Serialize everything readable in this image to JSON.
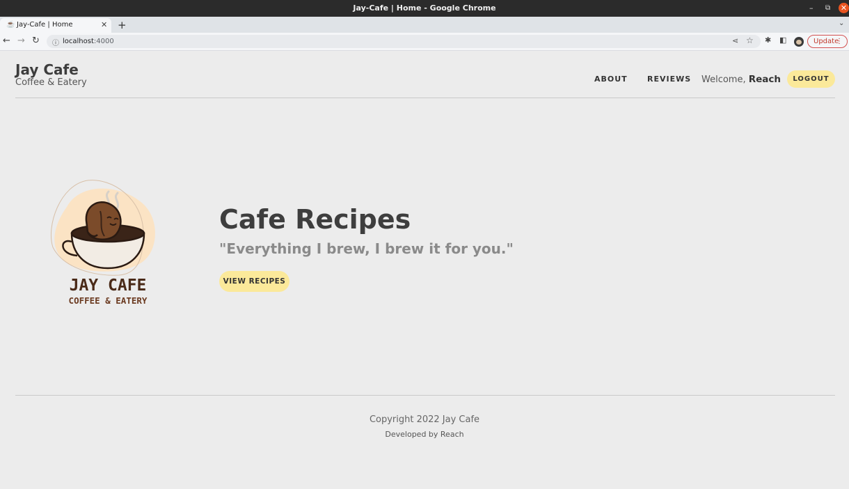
{
  "window": {
    "title": "Jay-Cafe | Home - Google Chrome",
    "controls": {
      "minimize": "–",
      "maximize": "⧉",
      "close": "✕"
    }
  },
  "browser": {
    "tab_title": "Jay-Cafe | Home",
    "tab_close": "✕",
    "new_tab": "+",
    "tab_menu": "⌄",
    "url_host": "localhost",
    "url_port": ":4000",
    "update_label": "Update",
    "update_menu": "⋮",
    "icons": {
      "back": "←",
      "forward": "→",
      "reload": "↻",
      "info": "ⓘ",
      "share": "⋖",
      "star": "☆",
      "extensions": "✱",
      "side_panel": "◧",
      "favicon": "☕"
    }
  },
  "header": {
    "brand_name": "Jay Cafe",
    "brand_tagline": "Coffee & Eatery",
    "nav": {
      "about": "ABOUT",
      "reviews": "REVIEWS"
    },
    "welcome_prefix": "Welcome, ",
    "username": "Reach",
    "logout_label": "LOGOUT"
  },
  "hero": {
    "logo_title": "JAY CAFE",
    "logo_subtitle": "COFFEE & EATERY",
    "title": "Cafe Recipes",
    "quote": "\"Everything I brew, I brew it for you.\"",
    "cta_label": "VIEW RECIPES"
  },
  "footer": {
    "copyright": "Copyright 2022 Jay Cafe",
    "developer": "Developed by Reach"
  },
  "colors": {
    "page_background": "#ececec",
    "button_yellow": "#fbe99a",
    "text_dark": "#3e3e3e",
    "quote_gray": "#8a8a8a",
    "logo_brown": "#4a2a18"
  }
}
